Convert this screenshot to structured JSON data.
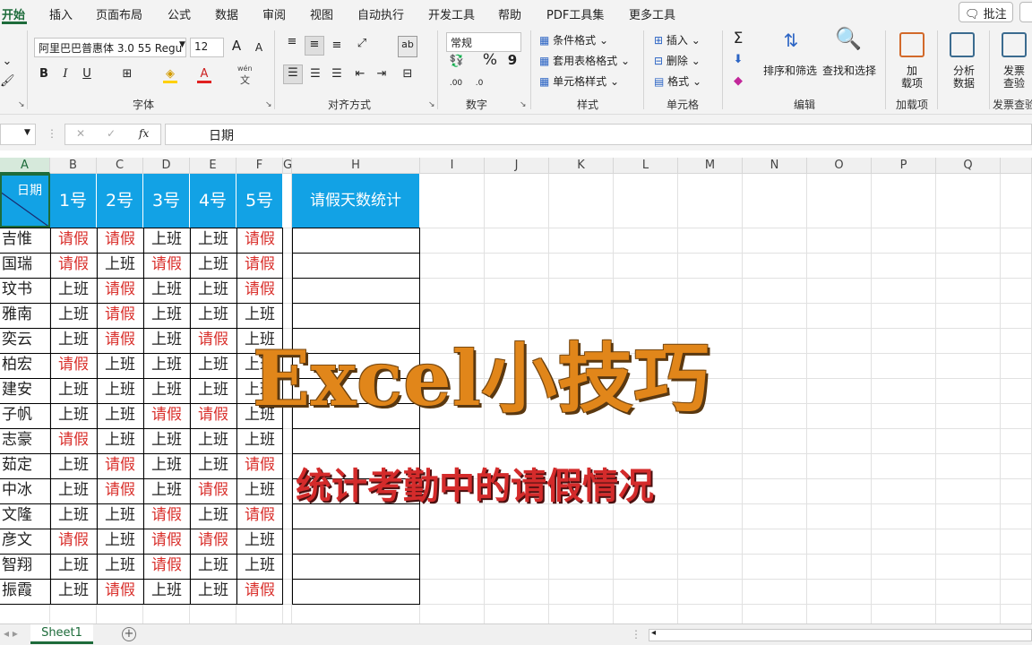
{
  "menu": {
    "tabs": [
      "开始",
      "插入",
      "页面布局",
      "公式",
      "数据",
      "审阅",
      "视图",
      "自动执行",
      "开发工具",
      "帮助",
      "PDF工具集",
      "更多工具"
    ],
    "comment_btn": "批注",
    "comment_icon": "comment-icon"
  },
  "ribbon": {
    "font": {
      "name": "阿里巴巴普惠体 3.0 55 Regu",
      "size": "12",
      "bold": "B",
      "italic": "I",
      "underline": "U",
      "grow": "A",
      "shrink": "A",
      "pinyin_top": "wén",
      "pinyin_bottom": "文",
      "group": "字体"
    },
    "align": {
      "group": "对齐方式"
    },
    "number": {
      "format": "常规",
      "percent": "%",
      "comma": "9",
      "inc": ".00",
      "dec": ".0",
      "group": "数字"
    },
    "styles": {
      "cond": "条件格式",
      "table": "套用表格格式",
      "cell": "单元格样式",
      "group": "样式"
    },
    "cells": {
      "insert": "插入",
      "delete": "删除",
      "format": "格式",
      "group": "单元格"
    },
    "editing": {
      "sum": "Σ",
      "sort": "排序和筛选",
      "find": "查找和选择",
      "group": "编辑"
    },
    "addins": {
      "label1": "加",
      "label2": "载项",
      "group": "加载项"
    },
    "analyze": {
      "label1": "分析",
      "label2": "数据"
    },
    "invoice": {
      "label1": "发票",
      "label2": "查验",
      "group": "发票查验"
    }
  },
  "formula": {
    "fx": "fx",
    "value": "日期",
    "cancel": "✕",
    "confirm": "✓"
  },
  "columns": [
    "A",
    "B",
    "C",
    "D",
    "E",
    "F",
    "G",
    "H",
    "I",
    "J",
    "K",
    "L",
    "M",
    "N",
    "O",
    "P",
    "Q",
    ""
  ],
  "table": {
    "corner": "日期",
    "days": [
      "1号",
      "2号",
      "3号",
      "4号",
      "5号"
    ],
    "stat_header": "请假天数统计",
    "rows": [
      {
        "name": "吉惟",
        "v": [
          "请假",
          "请假",
          "上班",
          "上班",
          "请假"
        ]
      },
      {
        "name": "国瑞",
        "v": [
          "请假",
          "上班",
          "请假",
          "上班",
          "请假"
        ]
      },
      {
        "name": "玟书",
        "v": [
          "上班",
          "请假",
          "上班",
          "上班",
          "请假"
        ]
      },
      {
        "name": "雅南",
        "v": [
          "上班",
          "请假",
          "上班",
          "上班",
          "上班"
        ]
      },
      {
        "name": "奕云",
        "v": [
          "上班",
          "请假",
          "上班",
          "请假",
          "上班"
        ]
      },
      {
        "name": "柏宏",
        "v": [
          "请假",
          "上班",
          "上班",
          "上班",
          "上班"
        ]
      },
      {
        "name": "建安",
        "v": [
          "上班",
          "上班",
          "上班",
          "上班",
          "上班"
        ]
      },
      {
        "name": "子帆",
        "v": [
          "上班",
          "上班",
          "请假",
          "请假",
          "上班"
        ]
      },
      {
        "name": "志豪",
        "v": [
          "请假",
          "上班",
          "上班",
          "上班",
          "上班"
        ]
      },
      {
        "name": "茹定",
        "v": [
          "上班",
          "请假",
          "上班",
          "上班",
          "请假"
        ]
      },
      {
        "name": "中冰",
        "v": [
          "上班",
          "请假",
          "上班",
          "请假",
          "上班"
        ]
      },
      {
        "name": "文隆",
        "v": [
          "上班",
          "上班",
          "请假",
          "上班",
          "请假"
        ]
      },
      {
        "name": "彦文",
        "v": [
          "请假",
          "上班",
          "请假",
          "请假",
          "上班"
        ]
      },
      {
        "name": "智翔",
        "v": [
          "上班",
          "上班",
          "请假",
          "上班",
          "上班"
        ]
      },
      {
        "name": "振霞",
        "v": [
          "上班",
          "请假",
          "上班",
          "上班",
          "请假"
        ]
      }
    ]
  },
  "overlay": {
    "title": "Excel小技巧",
    "subtitle": "统计考勤中的请假情况"
  },
  "status": {
    "sheet": "Sheet1",
    "add": "+"
  },
  "colors": {
    "header_bg": "#12a2e5",
    "leave_red": "#d9302c",
    "accent_green": "#1d6b3a",
    "title_orange": "#e1861a"
  }
}
